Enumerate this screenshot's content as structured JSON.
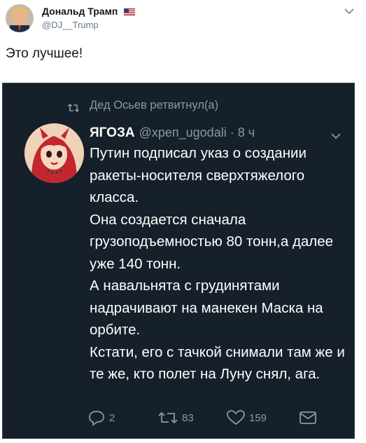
{
  "header": {
    "display_name": "Дональд Трамп",
    "handle": "@DJ__Trump"
  },
  "tweet": {
    "text": "Это лучшее!"
  },
  "embedded": {
    "retweet_line": "Дед Осьев ретвитнул(а)",
    "author_name": "ЯГОЗА",
    "author_handle": "@хреп_ugodali · 8 ч",
    "body": "Путин подписал указ о создании ракеты-носителя сверхтяжелого класса.\nОна создается сначала грузоподъемностью 80 тонн,а далее уже 140 тонн.\nА навальнята с грудинятами надрачивают на манекен Маска на орбите.\nКстати, его с тачкой снимали там же и те же, кто полет на Луну снял, ага.",
    "actions": {
      "reply_count": "2",
      "retweet_count": "83",
      "like_count": "159"
    }
  },
  "colors": {
    "dark_bg": "#15202b",
    "muted": "#8899a6",
    "accent": "#1da1f2"
  }
}
